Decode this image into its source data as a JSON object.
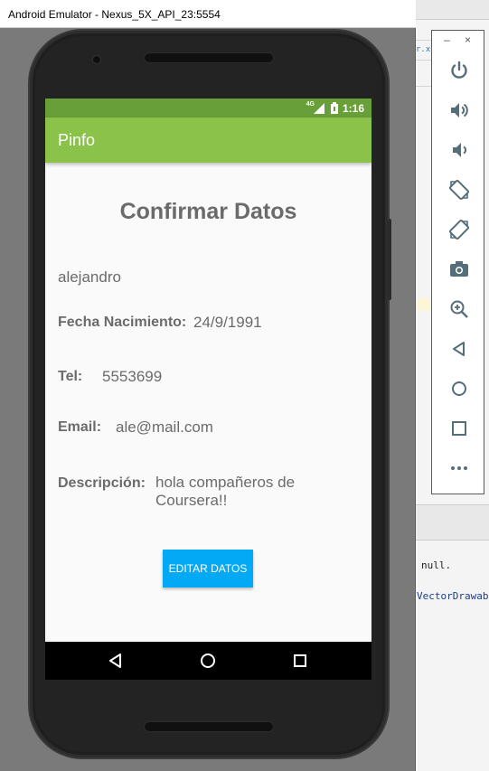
{
  "emulator": {
    "window_title": "Android Emulator - Nexus_5X_API_23:5554"
  },
  "status_bar": {
    "network": "4G",
    "time": "1:16",
    "color": "#689f38"
  },
  "app_bar": {
    "title": "Pinfo",
    "color": "#8bc34a"
  },
  "screen": {
    "heading": "Confirmar Datos",
    "name_value": "alejandro",
    "fields": {
      "birth_label": "Fecha Nacimiento:",
      "birth_value": "24/9/1991",
      "phone_label": "Tel:",
      "phone_value": "5553699",
      "email_label": "Email:",
      "email_value": "ale@mail.com",
      "desc_label": "Descripción:",
      "desc_value": "hola compañeros de Coursera!!"
    },
    "edit_button": "EDITAR DATOS",
    "edit_button_color": "#03a9f4"
  },
  "nav_bar": {
    "icons": [
      "back-icon",
      "home-icon",
      "recents-icon"
    ]
  },
  "toolbar": {
    "minimize": "–",
    "close": "×",
    "icons": [
      "power-icon",
      "volume-up-icon",
      "volume-down-icon",
      "rotate-left-icon",
      "rotate-right-icon",
      "camera-icon",
      "zoom-icon",
      "back-icon",
      "home-icon",
      "overview-icon",
      "more-icon"
    ]
  },
  "ide": {
    "tab_fragment": "r.xn",
    "code_line1": "null.",
    "code_line2": "VectorDrawab"
  }
}
